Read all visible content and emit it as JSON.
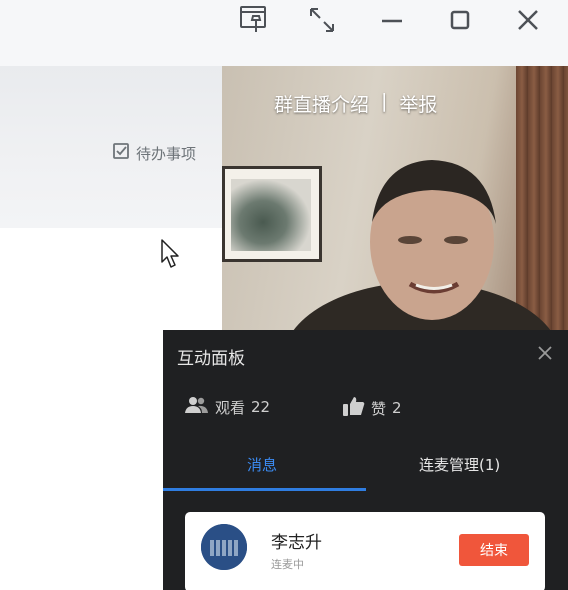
{
  "titlebar": {
    "icons": [
      "pin-icon",
      "expand-icon",
      "minimize-icon",
      "maximize-icon",
      "close-icon"
    ]
  },
  "left": {
    "todo_label": "待办事项",
    "todo_icon": "checkbox-icon"
  },
  "video": {
    "link_intro": "群直播介绍",
    "separator": "|",
    "link_report": "举报"
  },
  "panel": {
    "title": "互动面板",
    "viewers_label": "观看",
    "viewers_count": "22",
    "likes_label": "赞",
    "likes_count": "2",
    "tabs": [
      {
        "label": "消息",
        "active": true
      },
      {
        "label": "连麦管理(1)",
        "active": false
      }
    ],
    "mic_user": {
      "name": "李志升",
      "status": "连麦中",
      "end_label": "结束"
    }
  },
  "colors": {
    "accent_blue": "#2f7de1",
    "end_button": "#f0563b",
    "panel_bg": "#1f2022"
  }
}
